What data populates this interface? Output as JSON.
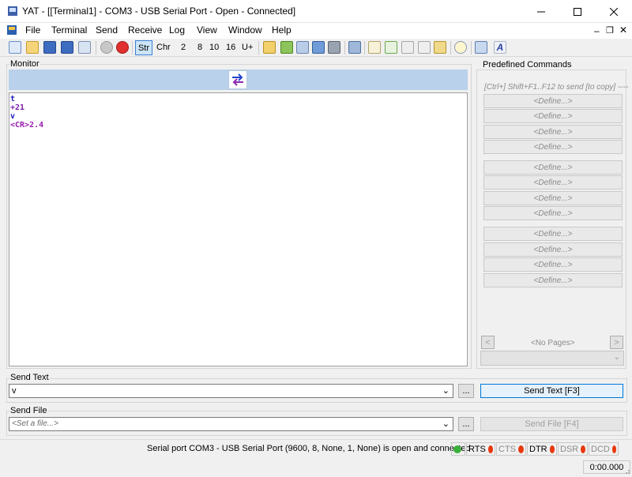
{
  "window": {
    "title": "YAT - [[Terminal1] - COM3 - USB Serial Port - Open - Connected]"
  },
  "menu": [
    "File",
    "Terminal",
    "Send",
    "Receive",
    "Log",
    "View",
    "Window",
    "Help"
  ],
  "toolbar": {
    "radix_labels": [
      "Str",
      "Chr",
      "2",
      "8",
      "10",
      "16",
      "U+"
    ]
  },
  "monitor": {
    "label": "Monitor",
    "lines": [
      {
        "text": "t",
        "color": "#1f1fc0"
      },
      {
        "text": "+21",
        "color": "#7a1fa8"
      },
      {
        "text": "v",
        "color": "#1f1fc0"
      },
      {
        "text": "<CR>2.4",
        "color": "#9a1fb0"
      }
    ]
  },
  "predefined": {
    "label": "Predefined Commands",
    "hint": "[Ctrl+] Shift+F1..F12 to send [to copy]",
    "define_label": "<Define...>",
    "no_pages": "<No Pages>"
  },
  "send_text": {
    "label": "Send Text",
    "value": "v",
    "browse": "...",
    "button": "Send Text [F3]"
  },
  "send_file": {
    "label": "Send File",
    "placeholder": "<Set a file...>",
    "browse": "...",
    "button": "Send File [F4]"
  },
  "status": {
    "message": "Serial port COM3 - USB Serial Port (9600, 8, None, 1, None) is open and connected",
    "signals": [
      {
        "name": "RTS",
        "color": "#e8380d",
        "enabled": true
      },
      {
        "name": "CTS",
        "color": "#e8380d",
        "enabled": false
      },
      {
        "name": "DTR",
        "color": "#e8380d",
        "enabled": true
      },
      {
        "name": "DSR",
        "color": "#e8380d",
        "enabled": false
      },
      {
        "name": "DCD",
        "color": "#e8380d",
        "enabled": false
      }
    ],
    "connection_led_color": "#3ab13a",
    "timer": "0:00.000"
  }
}
